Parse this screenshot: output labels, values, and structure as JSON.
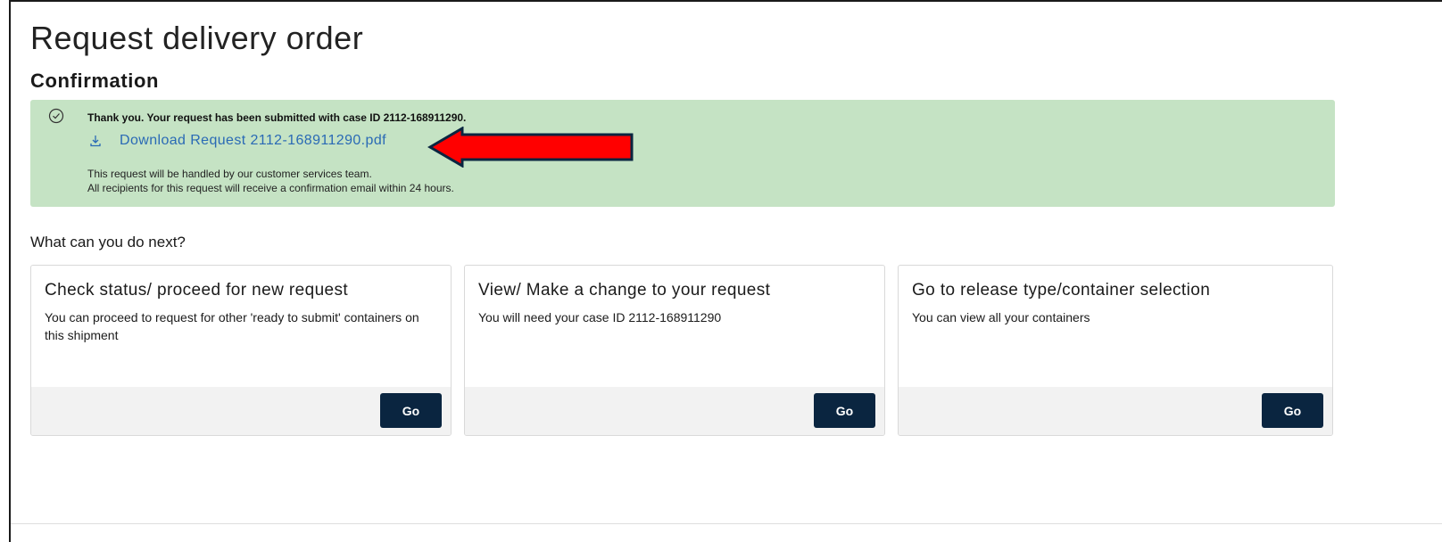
{
  "page": {
    "title": "Request delivery order",
    "section_title": "Confirmation"
  },
  "alert": {
    "message": "Thank you. Your request has been submitted with case ID 2112-168911290.",
    "download_label": "Download Request 2112-168911290.pdf",
    "info_line1": "This request will be handled by our customer services team.",
    "info_line2": "All recipients for this request will receive a confirmation email within 24 hours.",
    "icon": "check-circle-icon",
    "download_icon": "download-icon",
    "background_color": "#c5e3c4"
  },
  "next": {
    "heading": "What can you do next?",
    "cards": [
      {
        "title": "Check status/ proceed for new request",
        "description": "You can proceed to request for other 'ready to submit' containers on this shipment",
        "button_label": "Go"
      },
      {
        "title": "View/ Make a change to your request",
        "description": "You will need your case ID 2112-168911290",
        "button_label": "Go"
      },
      {
        "title": "Go to release type/container selection",
        "description": "You can view all your containers",
        "button_label": "Go"
      }
    ]
  },
  "annotation": {
    "arrow_color": "#ff0000",
    "arrow_outline_color": "#0a2540"
  },
  "colors": {
    "button_bg": "#0a2540",
    "link": "#2a6ab5"
  }
}
